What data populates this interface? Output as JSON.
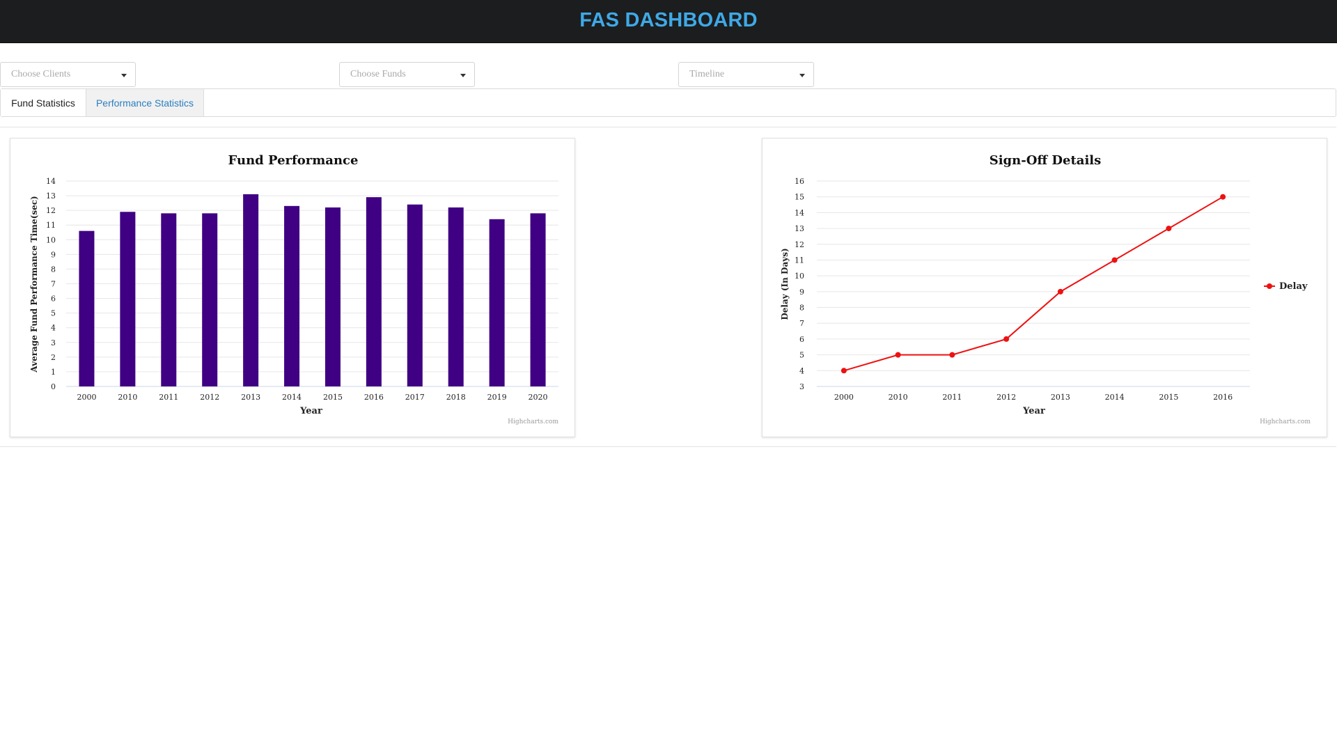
{
  "header": {
    "title": "FAS DASHBOARD"
  },
  "filters": {
    "clients_placeholder": "Choose Clients",
    "funds_placeholder": "Choose Funds",
    "timeline_placeholder": "Timeline"
  },
  "tabs": [
    {
      "label": "Fund Statistics",
      "active": true
    },
    {
      "label": "Performance Statistics",
      "active": false
    }
  ],
  "colors": {
    "header_bg": "#1c1d1f",
    "title": "#3fa9e6",
    "bar": "#3f0083",
    "line": "#ee1111",
    "tab_link": "#2a7fbf"
  },
  "credits": "Highcharts.com",
  "chart_data": [
    {
      "type": "bar",
      "title": "Fund Performance",
      "xlabel": "Year",
      "ylabel": "Average Fund Performance Time(sec)",
      "categories": [
        "2000",
        "2010",
        "2011",
        "2012",
        "2013",
        "2014",
        "2015",
        "2016",
        "2017",
        "2018",
        "2019",
        "2020"
      ],
      "values": [
        10.6,
        11.9,
        11.8,
        11.8,
        13.1,
        12.3,
        12.2,
        12.9,
        12.4,
        12.2,
        11.4,
        11.8
      ],
      "ylim": [
        0,
        14
      ],
      "yticks": [
        0,
        1,
        2,
        3,
        4,
        5,
        6,
        7,
        8,
        9,
        10,
        11,
        12,
        13,
        14
      ],
      "grid": true,
      "legend": "none"
    },
    {
      "type": "line",
      "title": "Sign-Off Details",
      "xlabel": "Year",
      "ylabel": "Delay (In Days)",
      "categories": [
        "2000",
        "2010",
        "2011",
        "2012",
        "2013",
        "2014",
        "2015",
        "2016"
      ],
      "series": [
        {
          "name": "Delay",
          "values": [
            4,
            5,
            5,
            6,
            9,
            11,
            13,
            15
          ]
        }
      ],
      "ylim": [
        3,
        16
      ],
      "yticks": [
        3,
        4,
        5,
        6,
        7,
        8,
        9,
        10,
        11,
        12,
        13,
        14,
        15,
        16
      ],
      "grid": true,
      "legend": "right"
    }
  ]
}
